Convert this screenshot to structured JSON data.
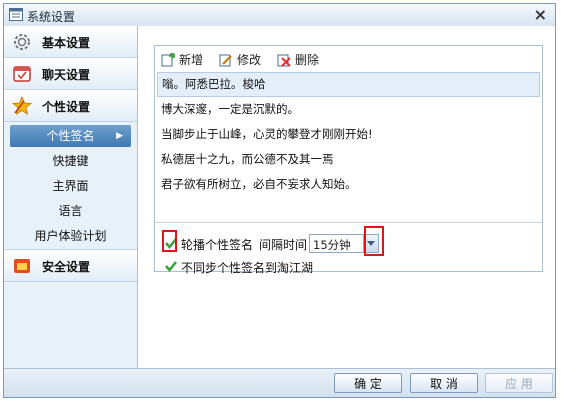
{
  "window": {
    "title": "系统设置",
    "close_label": "×"
  },
  "sidebar": {
    "categories": [
      {
        "label": "基本设置",
        "icon": "gear-icon"
      },
      {
        "label": "聊天设置",
        "icon": "chat-icon"
      },
      {
        "label": "个性设置",
        "icon": "star-icon"
      },
      {
        "label": "安全设置",
        "icon": "shield-icon"
      }
    ],
    "sub_items": [
      "个性签名",
      "快捷键",
      "主界面",
      "语言",
      "用户体验计划"
    ],
    "active_sub": "个性签名"
  },
  "toolbar": {
    "add": "新增",
    "edit": "修改",
    "delete": "删除"
  },
  "signatures": [
    "嗡。阿悉巴拉。梭哈",
    "博大深邃，一定是沉默的。",
    "当脚步止于山峰，心灵的攀登才刚刚开始!",
    "私德居十之九，而公德不及其一焉",
    "君子欲有所树立，必自不妄求人知始。"
  ],
  "options": {
    "rotate_label": "轮播个性签名",
    "rotate_checked": true,
    "interval_label": "间隔时间：",
    "interval_value": "15分钟",
    "nosync_label": "不同步个性签名到淘江湖",
    "nosync_checked": true
  },
  "buttons": {
    "ok": "确 定",
    "cancel": "取 消",
    "apply": "应 用"
  },
  "colors": {
    "accent": "#3f78b0",
    "highlight_box": "#e2121a",
    "check": "#3aa13a"
  }
}
